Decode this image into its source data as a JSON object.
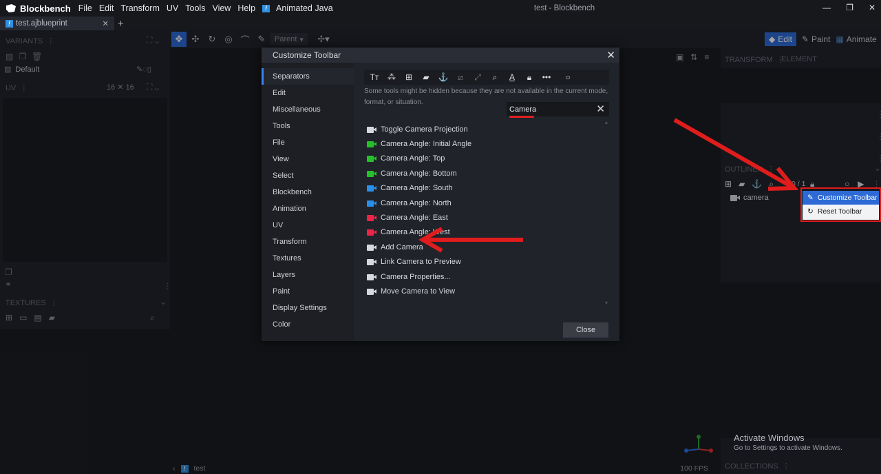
{
  "app": {
    "name": "Blockbench",
    "window_title": "test - Blockbench",
    "menus": [
      "File",
      "Edit",
      "Transform",
      "UV",
      "Tools",
      "View",
      "Help"
    ],
    "plugin_menu": "Animated Java"
  },
  "tab": {
    "name": "test.ajblueprint"
  },
  "left": {
    "variants_title": "VARIANTS",
    "default_variant": "Default",
    "uv_title": "UV",
    "uv_size": "16 ✕ 16",
    "textures_title": "TEXTURES"
  },
  "toolbar": {
    "parent_label": "Parent"
  },
  "modes": {
    "edit": "Edit",
    "paint": "Paint",
    "animate": "Animate"
  },
  "right": {
    "transform_title": "TRANSFORM",
    "element_title": "ELEMENT",
    "outliner_title": "OUTLINER",
    "outliner_count": "0 / 1",
    "camera_node": "camera",
    "collections_title": "COLLECTIONS"
  },
  "dialog": {
    "title": "Customize Toolbar",
    "categories": [
      "Separators",
      "Edit",
      "Miscellaneous",
      "Tools",
      "File",
      "View",
      "Select",
      "Blockbench",
      "Animation",
      "UV",
      "Transform",
      "Textures",
      "Layers",
      "Paint",
      "Display Settings",
      "Color"
    ],
    "selected_category": "Separators",
    "hint": "Some tools might be hidden because they are not available in the current mode, format, or situation.",
    "search_value": "Camera",
    "results": [
      {
        "label": "Toggle Camera Projection",
        "icon_color": "#d6d8dd"
      },
      {
        "label": "Camera Angle: Initial Angle",
        "icon_color": "#26c12a"
      },
      {
        "label": "Camera Angle: Top",
        "icon_color": "#26c12a"
      },
      {
        "label": "Camera Angle: Bottom",
        "icon_color": "#26c12a"
      },
      {
        "label": "Camera Angle: South",
        "icon_color": "#2a8fe8"
      },
      {
        "label": "Camera Angle: North",
        "icon_color": "#2a8fe8"
      },
      {
        "label": "Camera Angle: East",
        "icon_color": "#ec2448"
      },
      {
        "label": "Camera Angle: West",
        "icon_color": "#ec2448"
      },
      {
        "label": "Add Camera",
        "icon_color": "#d6d8dd"
      },
      {
        "label": "Link Camera to Preview",
        "icon_color": "#d6d8dd"
      },
      {
        "label": "Camera Properties...",
        "icon_color": "#d6d8dd"
      },
      {
        "label": "Move Camera to View",
        "icon_color": "#d6d8dd"
      }
    ],
    "close_label": "Close"
  },
  "context_menu": {
    "customize": "Customize Toolbar",
    "reset": "Reset Toolbar"
  },
  "status": {
    "project": "test",
    "fps": "100 FPS"
  },
  "watermark": {
    "title": "Activate Windows",
    "subtitle": "Go to Settings to activate Windows."
  },
  "colors": {
    "accent": "#2d6ad6",
    "annotation_red": "#e01c1c"
  }
}
